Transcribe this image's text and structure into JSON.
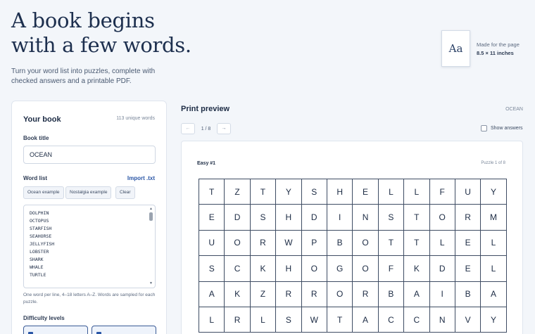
{
  "hero": {
    "title_line1": "A book begins",
    "title_line2": "with a few words.",
    "subtitle": "Turn your word list into puzzles, complete with checked answers and a printable PDF."
  },
  "page_badge": {
    "glyph": "Aa",
    "made_for": "Made for the page",
    "size": "8.5 × 11 inches"
  },
  "book": {
    "heading": "Your book",
    "unique_count": "113 unique words",
    "title_label": "Book title",
    "title_value": "OCEAN",
    "wordlist_label": "Word list",
    "import_label": "Import .txt",
    "chips": [
      "Ocean example",
      "Nostalgia example",
      "Clear"
    ],
    "words": [
      "DOLPHIN",
      "OCTOPUS",
      "STARFISH",
      "SEAHORSE",
      "JELLYFISH",
      "LOBSTER",
      "SHARK",
      "WHALE",
      "TURTLE"
    ],
    "help": "One word per line, 4–18 letters A–Z. Words are sampled for each puzzle.",
    "difficulty_label": "Difficulty levels"
  },
  "preview": {
    "title": "Print preview",
    "tag": "OCEAN",
    "prev_icon": "←",
    "next_icon": "→",
    "page_indicator": "1 / 8",
    "show_answers_label": "Show answers",
    "show_answers_checked": false,
    "puzzle_name": "Easy #1",
    "puzzle_count": "Puzzle 1 of 8",
    "grid": [
      [
        "T",
        "Z",
        "T",
        "Y",
        "S",
        "H",
        "E",
        "L",
        "L",
        "F",
        "U",
        "Y"
      ],
      [
        "E",
        "D",
        "S",
        "H",
        "D",
        "I",
        "N",
        "S",
        "T",
        "O",
        "R",
        "M"
      ],
      [
        "U",
        "O",
        "R",
        "W",
        "P",
        "B",
        "O",
        "T",
        "T",
        "L",
        "E",
        "L"
      ],
      [
        "S",
        "C",
        "K",
        "H",
        "O",
        "G",
        "O",
        "F",
        "K",
        "D",
        "E",
        "L"
      ],
      [
        "A",
        "K",
        "Z",
        "R",
        "R",
        "O",
        "R",
        "B",
        "A",
        "I",
        "B",
        "A"
      ],
      [
        "L",
        "R",
        "L",
        "S",
        "W",
        "T",
        "A",
        "C",
        "C",
        "N",
        "V",
        "Y"
      ]
    ]
  },
  "colors": {
    "background": "#f3f6fa",
    "ink": "#1c2b44",
    "accent": "#2a56a6"
  }
}
